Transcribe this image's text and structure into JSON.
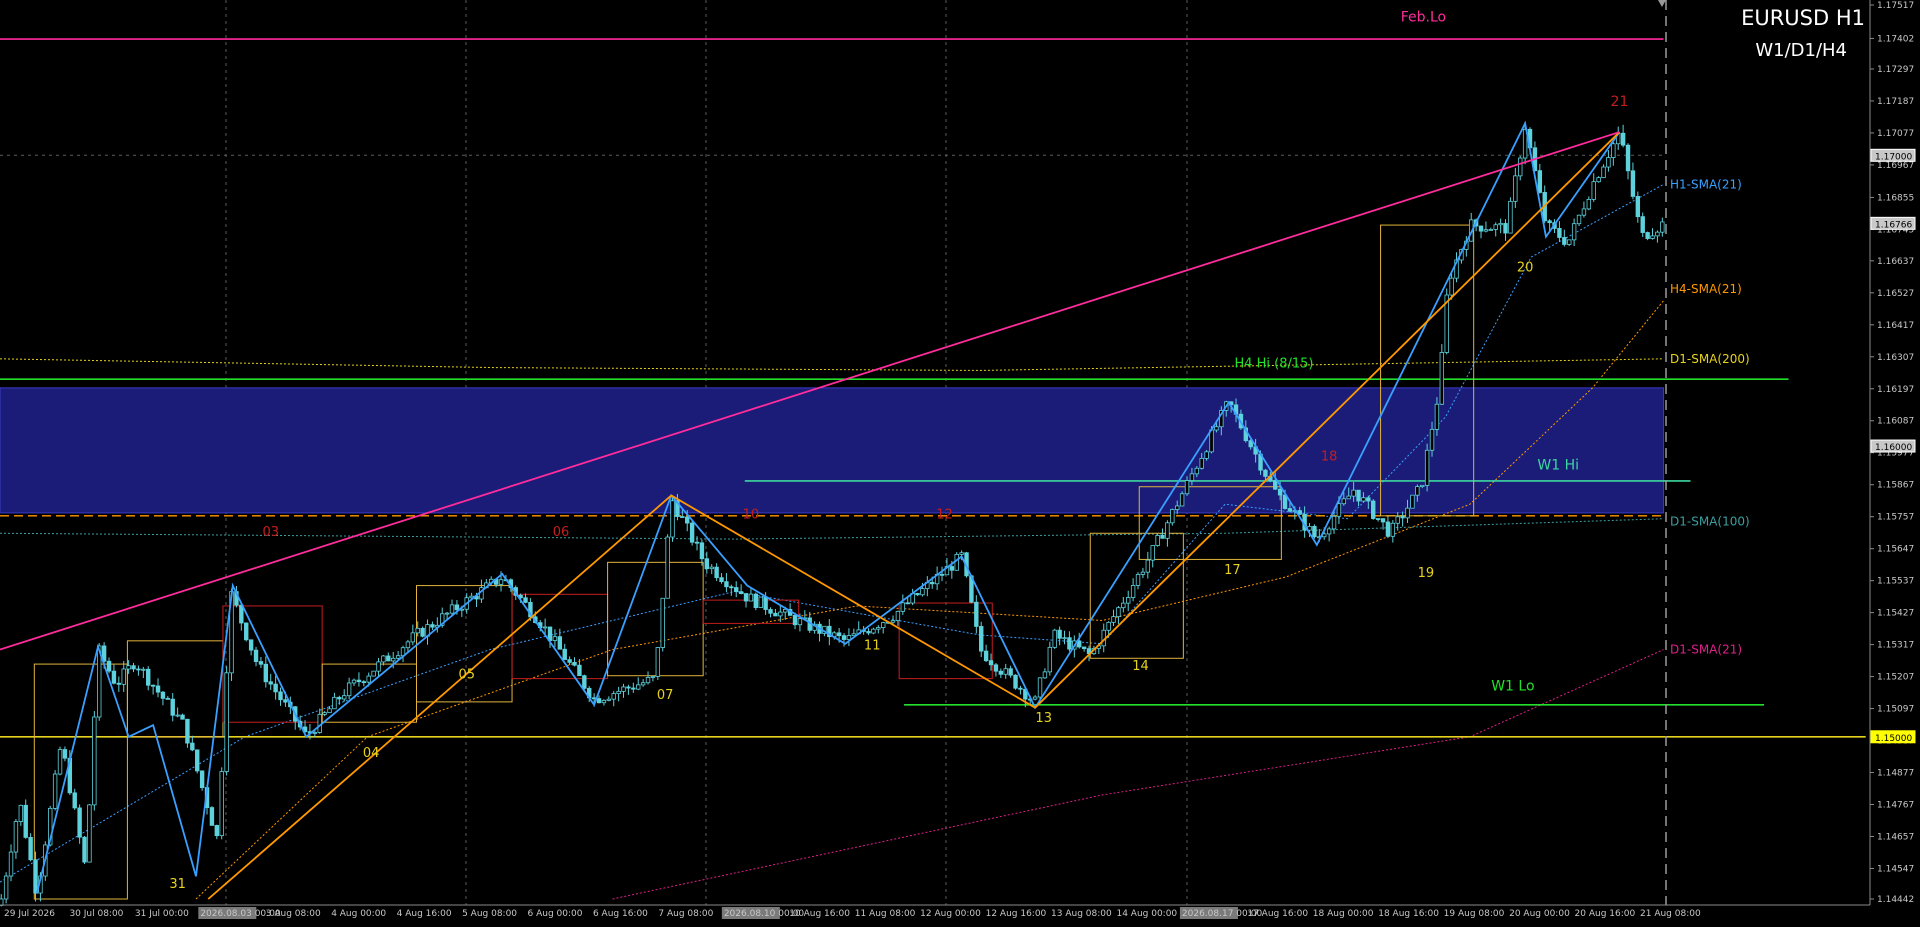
{
  "header": {
    "symbol_tf": "EURUSD H1",
    "tf_set": "W1/D1/H4"
  },
  "colors": {
    "background": "#000000",
    "grid": "#5a5a5a",
    "candle": "#5ed2dc",
    "zigzag": "#3aa0ff",
    "trend": "#ff9800",
    "pink_trend": "#ff2c9c",
    "box_gold": "#e2b43c",
    "box_red": "#c41e1e",
    "zone": "#1a1c78",
    "green": "#22e02c",
    "w1_hi": "#3cd7a0",
    "h1_sma": "#3aa0ff",
    "h4_sma": "#ff9800",
    "d1_sma200": "#e6d21e",
    "d1_sma100": "#3c9ea0",
    "d1_sma21": "#e0208c"
  },
  "chart_data": {
    "type": "candlestick",
    "symbol": "EURUSD",
    "timeframe": "H1",
    "ylim": [
      1.14442,
      1.17517
    ],
    "price_axis_ticks": [
      "1.17517",
      "1.17402",
      "1.17297",
      "1.17187",
      "1.17077",
      "1.16967",
      "1.16855",
      "1.16745",
      "1.16637",
      "1.16527",
      "1.16417",
      "1.16307",
      "1.16197",
      "1.16087",
      "1.15977",
      "1.15867",
      "1.15757",
      "1.15647",
      "1.15537",
      "1.15427",
      "1.15317",
      "1.15207",
      "1.15097",
      "1.14987",
      "1.14877",
      "1.14767",
      "1.14657",
      "1.14547",
      "1.14442"
    ],
    "price_highlights": [
      {
        "label": "1.17000",
        "price": 1.17,
        "style": "box"
      },
      {
        "label": "1.16766",
        "price": 1.16766,
        "style": "box"
      },
      {
        "label": "1.16000",
        "price": 1.16,
        "style": "box"
      },
      {
        "label": "1.15000",
        "price": 1.15,
        "style": "yellow"
      }
    ],
    "time_labels": [
      "29 Jul 2026",
      "30 Jul 08:00",
      "31 Jul 00:00",
      "2026.08.03 00:00",
      "3 Aug 08:00",
      "4 Aug 00:00",
      "4 Aug 16:00",
      "5 Aug 08:00",
      "6 Aug 00:00",
      "6 Aug 16:00",
      "7 Aug 08:00",
      "2026.08.10 00:00",
      "10 Aug 16:00",
      "11 Aug 08:00",
      "12 Aug 00:00",
      "12 Aug 16:00",
      "13 Aug 08:00",
      "14 Aug 00:00",
      "2026.08.17 00:00",
      "17 Aug 16:00",
      "18 Aug 00:00",
      "18 Aug 16:00",
      "19 Aug 08:00",
      "20 Aug 00:00",
      "20 Aug 16:00",
      "21 Aug 08:00"
    ],
    "swing_points": [
      {
        "x": 0,
        "price": 1.1442
      },
      {
        "x": 16,
        "price": 1.1478
      },
      {
        "x": 30,
        "price": 1.1446
      },
      {
        "x": 50,
        "price": 1.1498
      },
      {
        "x": 70,
        "price": 1.1454
      },
      {
        "x": 80,
        "price": 1.153
      },
      {
        "x": 95,
        "price": 1.1518
      },
      {
        "x": 110,
        "price": 1.1526
      },
      {
        "x": 150,
        "price": 1.1504
      },
      {
        "x": 178,
        "price": 1.1464
      },
      {
        "x": 188,
        "price": 1.155
      },
      {
        "x": 210,
        "price": 1.1525
      },
      {
        "x": 250,
        "price": 1.15
      },
      {
        "x": 280,
        "price": 1.1515
      },
      {
        "x": 340,
        "price": 1.1535
      },
      {
        "x": 410,
        "price": 1.1555
      },
      {
        "x": 440,
        "price": 1.154
      },
      {
        "x": 485,
        "price": 1.1513
      },
      {
        "x": 535,
        "price": 1.152
      },
      {
        "x": 548,
        "price": 1.1582
      },
      {
        "x": 575,
        "price": 1.156
      },
      {
        "x": 610,
        "price": 1.1548
      },
      {
        "x": 650,
        "price": 1.154
      },
      {
        "x": 690,
        "price": 1.1533
      },
      {
        "x": 730,
        "price": 1.1542
      },
      {
        "x": 785,
        "price": 1.1562
      },
      {
        "x": 800,
        "price": 1.153
      },
      {
        "x": 845,
        "price": 1.1512
      },
      {
        "x": 860,
        "price": 1.1535
      },
      {
        "x": 890,
        "price": 1.1528
      },
      {
        "x": 940,
        "price": 1.1563
      },
      {
        "x": 1003,
        "price": 1.1615
      },
      {
        "x": 1040,
        "price": 1.1585
      },
      {
        "x": 1075,
        "price": 1.1568
      },
      {
        "x": 1105,
        "price": 1.1585
      },
      {
        "x": 1135,
        "price": 1.157
      },
      {
        "x": 1160,
        "price": 1.1586
      },
      {
        "x": 1175,
        "price": 1.162
      },
      {
        "x": 1182,
        "price": 1.1656
      },
      {
        "x": 1200,
        "price": 1.1676
      },
      {
        "x": 1230,
        "price": 1.1675
      },
      {
        "x": 1245,
        "price": 1.171
      },
      {
        "x": 1262,
        "price": 1.1676
      },
      {
        "x": 1280,
        "price": 1.167
      },
      {
        "x": 1300,
        "price": 1.169
      },
      {
        "x": 1322,
        "price": 1.1708
      },
      {
        "x": 1340,
        "price": 1.1672
      },
      {
        "x": 1358,
        "price": 1.16766
      }
    ],
    "zigzag": [
      {
        "x": 30,
        "price": 1.1446
      },
      {
        "x": 80,
        "price": 1.1531
      },
      {
        "x": 105,
        "price": 1.15
      },
      {
        "x": 125,
        "price": 1.1504
      },
      {
        "x": 160,
        "price": 1.1452
      },
      {
        "x": 190,
        "price": 1.1552
      },
      {
        "x": 250,
        "price": 1.15
      },
      {
        "x": 410,
        "price": 1.1556
      },
      {
        "x": 485,
        "price": 1.1511
      },
      {
        "x": 548,
        "price": 1.1583
      },
      {
        "x": 610,
        "price": 1.1552
      },
      {
        "x": 690,
        "price": 1.1532
      },
      {
        "x": 785,
        "price": 1.1562
      },
      {
        "x": 845,
        "price": 1.151
      },
      {
        "x": 1003,
        "price": 1.1615
      },
      {
        "x": 1075,
        "price": 1.1566
      },
      {
        "x": 1245,
        "price": 1.1711
      },
      {
        "x": 1262,
        "price": 1.1672
      },
      {
        "x": 1322,
        "price": 1.1708
      }
    ],
    "trend_lines": [
      {
        "name": "orange-trend-1",
        "color_key": "trend",
        "points": [
          {
            "x": 170,
            "price": 1.14442
          },
          {
            "x": 548,
            "price": 1.1583
          }
        ]
      },
      {
        "name": "orange-trend-2",
        "color_key": "trend",
        "points": [
          {
            "x": 548,
            "price": 1.1583
          },
          {
            "x": 845,
            "price": 1.151
          }
        ]
      },
      {
        "name": "orange-trend-3",
        "color_key": "trend",
        "points": [
          {
            "x": 845,
            "price": 1.151
          },
          {
            "x": 1322,
            "price": 1.1708
          }
        ]
      },
      {
        "name": "pink-trend",
        "color_key": "pink_trend",
        "points": [
          {
            "x": 0,
            "price": 1.153
          },
          {
            "x": 1322,
            "price": 1.1708
          }
        ]
      }
    ],
    "horizontal_lines": [
      {
        "name": "feb-lo-line",
        "price": 1.174,
        "color_key": "pink_trend",
        "x0": 0,
        "x1": 1358,
        "style": "solid"
      },
      {
        "name": "h4-hi-line",
        "price": 1.1623,
        "color_key": "green",
        "x0": 0,
        "x1": 1460,
        "style": "solid"
      },
      {
        "name": "w1-hi-line",
        "price": 1.1588,
        "color_key": "w1_hi",
        "x0": 608,
        "x1": 1380,
        "style": "solid"
      },
      {
        "name": "w1-lo-line",
        "price": 1.1511,
        "color_key": "green",
        "x0": 738,
        "x1": 1440,
        "style": "solid"
      },
      {
        "name": "round-1.15-line",
        "price": 1.15,
        "color_key": "d1_sma200",
        "x0": 0,
        "x1": 1523,
        "style": "solid"
      },
      {
        "name": "orange-dash-line",
        "price": 1.1576,
        "color_key": "trend",
        "x0": 0,
        "x1": 1358,
        "style": "dash"
      }
    ],
    "zone": {
      "price_top": 1.162,
      "price_bottom": 1.1577,
      "x0": 0,
      "x1": 1358
    },
    "boxes": [
      {
        "x0": 28,
        "x1": 104,
        "price_top": 1.1525,
        "price_bottom": 1.14442,
        "color_key": "box_gold"
      },
      {
        "x0": 104,
        "x1": 182,
        "price_top": 1.1533,
        "price_bottom": 1.15,
        "color_key": "box_gold"
      },
      {
        "x0": 182,
        "x1": 263,
        "price_top": 1.1545,
        "price_bottom": 1.1505,
        "color_key": "box_red"
      },
      {
        "x0": 263,
        "x1": 340,
        "price_top": 1.1525,
        "price_bottom": 1.1505,
        "color_key": "box_gold"
      },
      {
        "x0": 340,
        "x1": 418,
        "price_top": 1.1552,
        "price_bottom": 1.1512,
        "color_key": "box_gold"
      },
      {
        "x0": 418,
        "x1": 496,
        "price_top": 1.1549,
        "price_bottom": 1.152,
        "color_key": "box_red"
      },
      {
        "x0": 496,
        "x1": 574,
        "price_top": 1.156,
        "price_bottom": 1.1521,
        "color_key": "box_gold"
      },
      {
        "x0": 574,
        "x1": 652,
        "price_top": 1.1547,
        "price_bottom": 1.1539,
        "color_key": "box_red"
      },
      {
        "x0": 734,
        "x1": 810,
        "price_top": 1.1546,
        "price_bottom": 1.152,
        "color_key": "box_red"
      },
      {
        "x0": 890,
        "x1": 966,
        "price_top": 1.157,
        "price_bottom": 1.1527,
        "color_key": "box_gold"
      },
      {
        "x0": 930,
        "x1": 1046,
        "price_top": 1.1586,
        "price_bottom": 1.1561,
        "color_key": "box_gold"
      },
      {
        "x0": 1127,
        "x1": 1203,
        "price_top": 1.1676,
        "price_bottom": 1.1576,
        "color_key": "box_gold"
      }
    ],
    "moving_averages": [
      {
        "name": "H1-SMA(21)",
        "color_key": "h1_sma",
        "style": "dot",
        "points": [
          {
            "x": 0,
            "price": 1.145
          },
          {
            "x": 200,
            "price": 1.15
          },
          {
            "x": 400,
            "price": 1.153
          },
          {
            "x": 600,
            "price": 1.155
          },
          {
            "x": 800,
            "price": 1.1535
          },
          {
            "x": 900,
            "price": 1.1532
          },
          {
            "x": 1000,
            "price": 1.158
          },
          {
            "x": 1100,
            "price": 1.1575
          },
          {
            "x": 1180,
            "price": 1.161
          },
          {
            "x": 1250,
            "price": 1.1665
          },
          {
            "x": 1358,
            "price": 1.169
          }
        ]
      },
      {
        "name": "H4-SMA(21)",
        "color_key": "h4_sma",
        "style": "dot",
        "points": [
          {
            "x": 160,
            "price": 1.14442
          },
          {
            "x": 300,
            "price": 1.15
          },
          {
            "x": 500,
            "price": 1.153
          },
          {
            "x": 700,
            "price": 1.1545
          },
          {
            "x": 900,
            "price": 1.154
          },
          {
            "x": 1050,
            "price": 1.1555
          },
          {
            "x": 1200,
            "price": 1.158
          },
          {
            "x": 1300,
            "price": 1.162
          },
          {
            "x": 1358,
            "price": 1.165
          }
        ]
      },
      {
        "name": "D1-SMA(200)",
        "color_key": "d1_sma200",
        "style": "dot",
        "points": [
          {
            "x": 0,
            "price": 1.163
          },
          {
            "x": 400,
            "price": 1.1627
          },
          {
            "x": 800,
            "price": 1.1626
          },
          {
            "x": 1358,
            "price": 1.163
          }
        ]
      },
      {
        "name": "D1-SMA(100)",
        "color_key": "d1_sma100",
        "style": "dot",
        "points": [
          {
            "x": 0,
            "price": 1.157
          },
          {
            "x": 600,
            "price": 1.1568
          },
          {
            "x": 1000,
            "price": 1.157
          },
          {
            "x": 1358,
            "price": 1.1575
          }
        ]
      },
      {
        "name": "D1-SMA(21)",
        "color_key": "d1_sma21",
        "style": "dot",
        "points": [
          {
            "x": 500,
            "price": 1.14442
          },
          {
            "x": 900,
            "price": 1.148
          },
          {
            "x": 1200,
            "price": 1.15
          },
          {
            "x": 1358,
            "price": 1.153
          }
        ]
      }
    ],
    "ma_labels": [
      {
        "text": "H1-SMA(21)",
        "price": 1.169,
        "color_key": "h1_sma"
      },
      {
        "text": "H4-SMA(21)",
        "price": 1.1654,
        "color_key": "h4_sma"
      },
      {
        "text": "D1-SMA(200)",
        "price": 1.163,
        "color_key": "d1_sma200"
      },
      {
        "text": "D1-SMA(100)",
        "price": 1.1574,
        "color_key": "d1_sma100"
      },
      {
        "text": "D1-SMA(21)",
        "price": 1.153,
        "color_key": "d1_sma21"
      }
    ],
    "annotations": [
      {
        "text": "Feb.Lo",
        "x": 1162,
        "price": 1.1746,
        "color_key": "pink_trend",
        "size": 14
      },
      {
        "text": "H4 Hi (8/15)",
        "x": 1040,
        "price": 1.1627,
        "color_key": "green",
        "size": 13
      },
      {
        "text": "W1 Hi",
        "x": 1272,
        "price": 1.1592,
        "color_key": "w1_hi",
        "size": 14
      },
      {
        "text": "W1 Lo",
        "x": 1235,
        "price": 1.1516,
        "color_key": "green",
        "size": 14
      },
      {
        "text": "03",
        "x": 221,
        "price": 1.1569,
        "color_key": "box_red",
        "size": 13
      },
      {
        "text": "06",
        "x": 458,
        "price": 1.1569,
        "color_key": "box_red",
        "size": 13
      },
      {
        "text": "10",
        "x": 613,
        "price": 1.1575,
        "color_key": "box_red",
        "size": 13
      },
      {
        "text": "12",
        "x": 771,
        "price": 1.1575,
        "color_key": "box_red",
        "size": 13
      },
      {
        "text": "18",
        "x": 1085,
        "price": 1.1595,
        "color_key": "box_red",
        "size": 13
      },
      {
        "text": "21",
        "x": 1322,
        "price": 1.1717,
        "color_key": "box_red",
        "size": 14
      },
      {
        "text": "31",
        "x": 145,
        "price": 1.1448,
        "color_key": "d1_sma200",
        "size": 13
      },
      {
        "text": "04",
        "x": 303,
        "price": 1.1493,
        "color_key": "d1_sma200",
        "size": 13
      },
      {
        "text": "05",
        "x": 381,
        "price": 1.152,
        "color_key": "d1_sma200",
        "size": 13
      },
      {
        "text": "07",
        "x": 543,
        "price": 1.1513,
        "color_key": "d1_sma200",
        "size": 13
      },
      {
        "text": "11",
        "x": 712,
        "price": 1.153,
        "color_key": "d1_sma200",
        "size": 13
      },
      {
        "text": "13",
        "x": 852,
        "price": 1.1505,
        "color_key": "d1_sma200",
        "size": 13
      },
      {
        "text": "14",
        "x": 931,
        "price": 1.1523,
        "color_key": "d1_sma200",
        "size": 13
      },
      {
        "text": "17",
        "x": 1006,
        "price": 1.1556,
        "color_key": "d1_sma200",
        "size": 13
      },
      {
        "text": "19",
        "x": 1164,
        "price": 1.1555,
        "color_key": "d1_sma200",
        "size": 13
      },
      {
        "text": "20",
        "x": 1245,
        "price": 1.166,
        "color_key": "d1_sma200",
        "size": 13
      }
    ]
  }
}
